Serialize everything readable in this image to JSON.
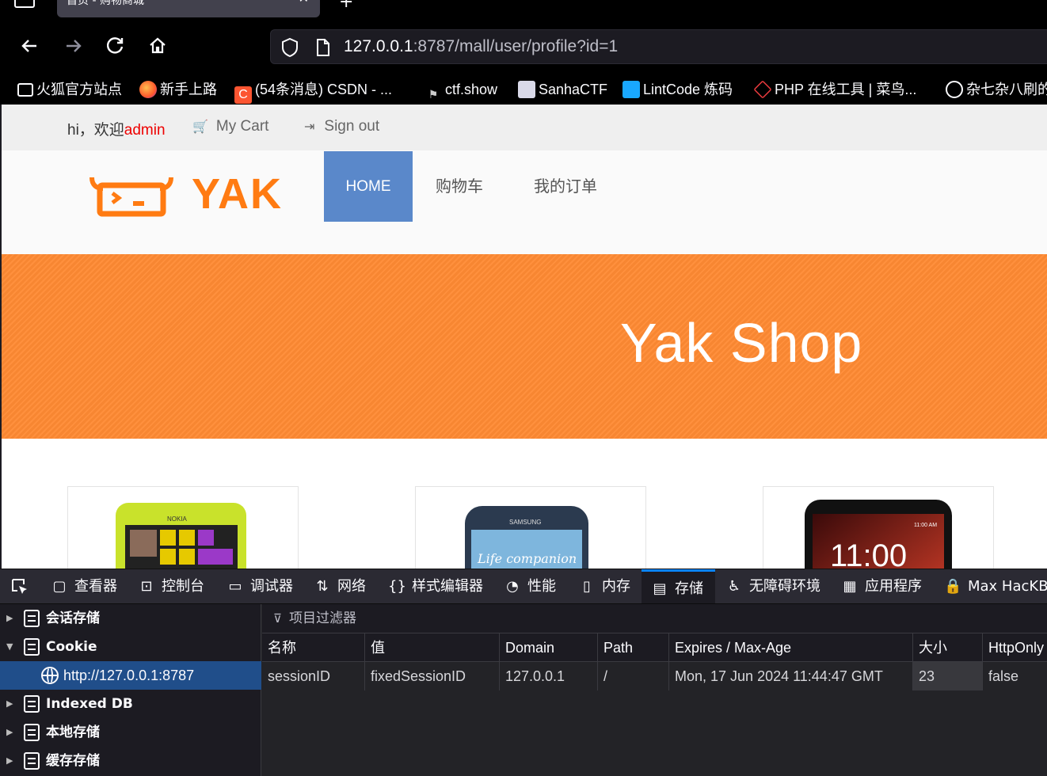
{
  "browser": {
    "tab_title": "首页 - 购物商城",
    "tab_close": "✕",
    "new_tab": "+",
    "url_host": "127.0.0.1",
    "url_rest": ":8787/mall/user/profile?id=1",
    "bookmarks": [
      "火狐官方站点",
      "新手上路",
      "(54条消息) CSDN - ...",
      "ctf.show",
      "SanhaCTF",
      "LintCode 炼码",
      "PHP 在线工具 | 菜鸟...",
      "杂七杂八刷的"
    ]
  },
  "site": {
    "greeting": "hi，欢迎",
    "username": "admin",
    "my_cart": "My Cart",
    "sign_out": "Sign out",
    "logo_text": "YAK",
    "menu": [
      "HOME",
      "购物车",
      "我的订单"
    ],
    "banner_title": "Yak Shop",
    "colors": {
      "accent": "#5a88ca",
      "banner": "#ff8a33",
      "logo": "#ff7b12"
    }
  },
  "devtools": {
    "tabs": [
      "查看器",
      "控制台",
      "调试器",
      "网络",
      "样式编辑器",
      "性能",
      "内存",
      "存储",
      "无障碍环境",
      "应用程序",
      "Max HacKB"
    ],
    "active_tab": "存储",
    "tree": [
      {
        "label": "会话存储"
      },
      {
        "label": "Cookie"
      },
      {
        "label": "http://127.0.0.1:8787"
      },
      {
        "label": "Indexed DB"
      },
      {
        "label": "本地存储"
      },
      {
        "label": "缓存存储"
      }
    ],
    "filter_placeholder": "项目过滤器",
    "columns": [
      "名称",
      "值",
      "Domain",
      "Path",
      "Expires / Max-Age",
      "大小",
      "HttpOnly"
    ],
    "row": [
      "sessionID",
      "fixedSessionID",
      "127.0.0.1",
      "/",
      "Mon, 17 Jun 2024 11:44:47 GMT",
      "23",
      "false"
    ]
  }
}
